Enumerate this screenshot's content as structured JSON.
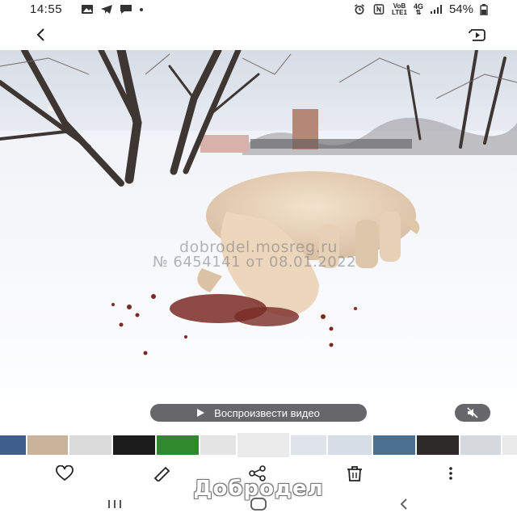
{
  "status_bar": {
    "time": "14:55",
    "network_top": "VoB",
    "network_bottom": "LTE1",
    "signal_label": "4G",
    "battery": "54%"
  },
  "top_bar": {
    "back_icon": "chevron-left-icon",
    "playlist_icon": "play-in-frame-icon"
  },
  "media": {
    "watermark_line1": "dobrodel.mosreg.ru",
    "watermark_line2": "№ 6454141 от 08.01.2022",
    "play_video_label": "Воспроизвести видео",
    "mute_icon": "speaker-muted-icon"
  },
  "thumbnails": [
    {
      "name": "thumb-1",
      "color": "#3f5e8e"
    },
    {
      "name": "thumb-2",
      "color": "#c9b39a"
    },
    {
      "name": "thumb-3",
      "color": "#dcdbdc"
    },
    {
      "name": "thumb-4",
      "color": "#1c1c1c"
    },
    {
      "name": "thumb-5",
      "color": "#2f8a2d"
    },
    {
      "name": "thumb-6",
      "color": "#e4e4e4"
    },
    {
      "name": "thumb-7",
      "color": "#ecebec"
    },
    {
      "name": "thumb-8",
      "color": "#dfe3ea"
    },
    {
      "name": "thumb-9",
      "color": "#d7dde6"
    },
    {
      "name": "thumb-10",
      "color": "#4a6f8f"
    },
    {
      "name": "thumb-11",
      "color": "#2d2a29"
    },
    {
      "name": "thumb-12",
      "color": "#d5d8dc"
    },
    {
      "name": "thumb-13",
      "color": "#eaeaea"
    }
  ],
  "actions": {
    "favorite_icon": "heart-icon",
    "edit_icon": "pencil-icon",
    "share_icon": "share-icon",
    "delete_icon": "trash-icon",
    "more_icon": "more-vertical-icon"
  },
  "brand_overlay": "Добродел",
  "nav": {
    "recents_icon": "recents-icon",
    "home_icon": "home-icon",
    "back_icon": "back-icon"
  }
}
